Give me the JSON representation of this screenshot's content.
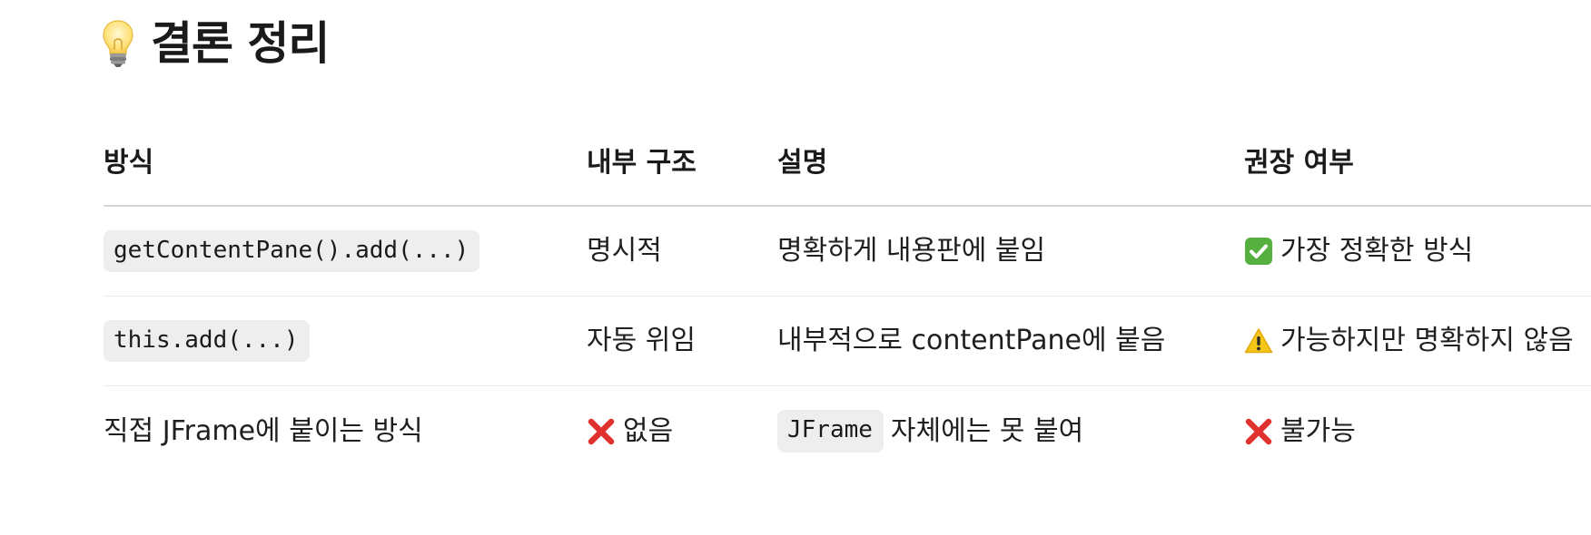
{
  "heading": {
    "icon": "lightbulb-icon",
    "title": "결론 정리"
  },
  "table": {
    "headers": [
      "방식",
      "내부 구조",
      "설명",
      "권장 여부"
    ],
    "rows": [
      {
        "method": "getContentPane().add(...)",
        "method_is_code": true,
        "structure": "명시적",
        "structure_icon": "",
        "description_code": "",
        "description": "명확하게 내용판에 붙임",
        "recommend_icon": "check-mark-icon",
        "recommend": "가장 정확한 방식"
      },
      {
        "method": "this.add(...)",
        "method_is_code": true,
        "structure": "자동 위임",
        "structure_icon": "",
        "description_code": "",
        "description": "내부적으로 contentPane에 붙음",
        "recommend_icon": "warning-icon",
        "recommend": "가능하지만 명확하지 않음"
      },
      {
        "method": "직접 JFrame에 붙이는 방식",
        "method_is_code": false,
        "structure": "없음",
        "structure_icon": "cross-mark-icon",
        "description_code": "JFrame",
        "description": "자체에는 못 붙여",
        "recommend_icon": "cross-mark-icon",
        "recommend": "불가능"
      }
    ]
  },
  "colors": {
    "check": "#56b03f",
    "warning": "#f5c518",
    "cross": "#e0312d",
    "code_bg": "#eeeeee"
  }
}
